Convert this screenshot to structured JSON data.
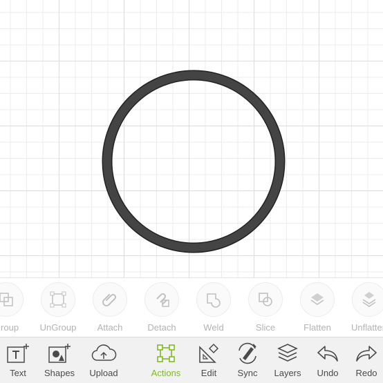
{
  "accent_color": "#7dbb1f",
  "canvas": {
    "shape": "ring",
    "shape_color": "#444444"
  },
  "actions_panel": {
    "items": [
      {
        "label": "Group",
        "icon": "group-icon"
      },
      {
        "label": "UnGroup",
        "icon": "ungroup-icon"
      },
      {
        "label": "Attach",
        "icon": "attach-icon"
      },
      {
        "label": "Detach",
        "icon": "detach-icon"
      },
      {
        "label": "Weld",
        "icon": "weld-icon"
      },
      {
        "label": "Slice",
        "icon": "slice-icon"
      },
      {
        "label": "Flatten",
        "icon": "flatten-icon"
      },
      {
        "label": "Unflatten",
        "icon": "unflatten-icon"
      }
    ]
  },
  "toolbar": {
    "items": [
      {
        "label": "Text",
        "icon": "text-icon"
      },
      {
        "label": "Shapes",
        "icon": "shapes-icon"
      },
      {
        "label": "Upload",
        "icon": "upload-icon"
      },
      {
        "label": "Actions",
        "icon": "actions-icon",
        "active": true
      },
      {
        "label": "Edit",
        "icon": "edit-icon"
      },
      {
        "label": "Sync",
        "icon": "sync-icon"
      },
      {
        "label": "Layers",
        "icon": "layers-icon"
      },
      {
        "label": "Undo",
        "icon": "undo-icon"
      },
      {
        "label": "Redo",
        "icon": "redo-icon"
      }
    ]
  }
}
